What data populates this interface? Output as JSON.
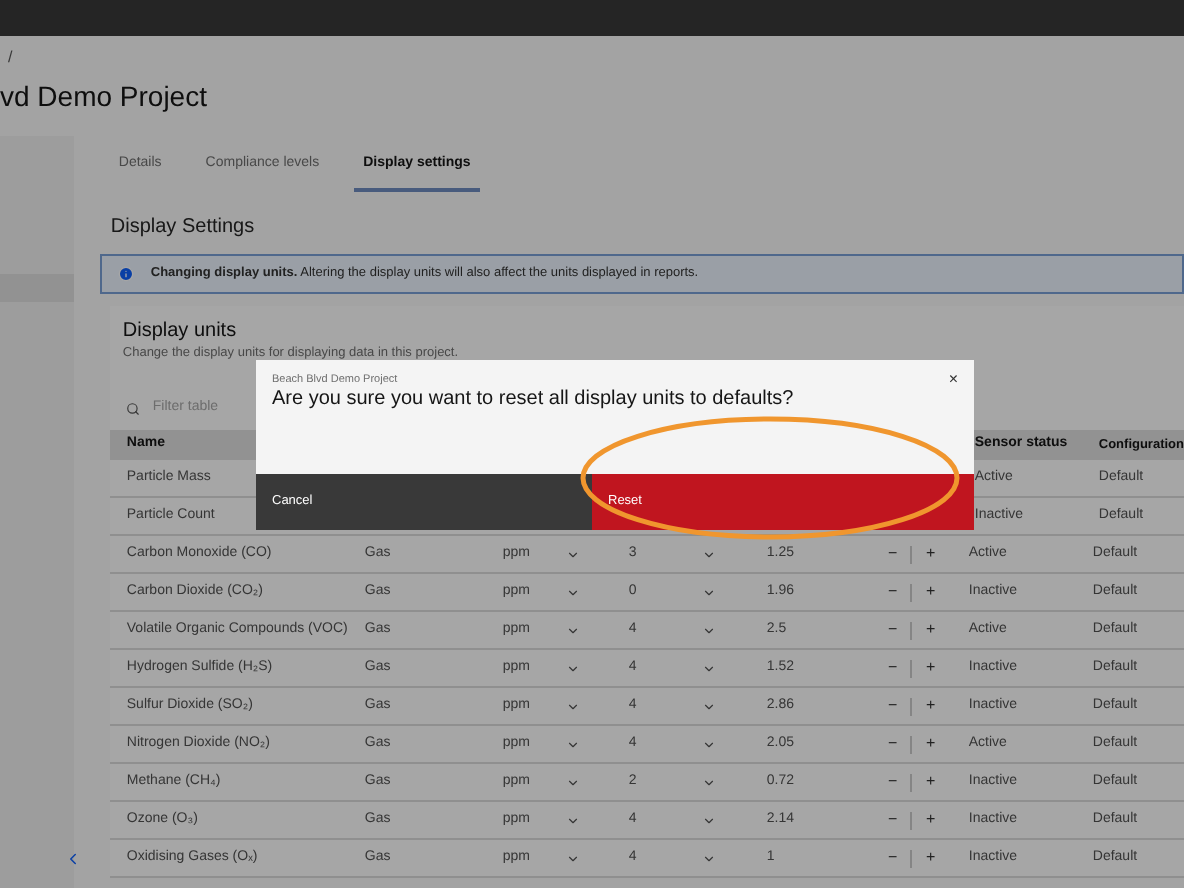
{
  "breadcrumb": "/",
  "project_title": "vd Demo Project",
  "tabs": [
    {
      "label": "Details",
      "selected": false
    },
    {
      "label": "Compliance levels",
      "selected": false
    },
    {
      "label": "Display settings",
      "selected": true
    }
  ],
  "section_title": "Display Settings",
  "notification": {
    "text": "**Changing display units.** Altering the display units will also affect the units displayed in reports."
  },
  "card": {
    "title": "Display units",
    "subtitle": "Change the display units for displaying data in this project."
  },
  "search": {
    "placeholder": "Filter table"
  },
  "table": {
    "columns": [
      "Name",
      "Sensor status",
      "Configuration"
    ],
    "rows": [
      {
        "name": "Particle Mass",
        "status": "Active",
        "config": "Default"
      },
      {
        "name": "Particle Count",
        "status": "Inactive",
        "config": "Default"
      },
      {
        "name": "Carbon Monoxide (CO)",
        "type": "Gas",
        "unit": "ppm",
        "decimals": "3",
        "value": "1.25",
        "minus": "−",
        "plus": "+",
        "status": "Active",
        "config": "Default"
      },
      {
        "name": "Carbon Dioxide (CO₂)",
        "type": "Gas",
        "unit": "ppm",
        "decimals": "0",
        "value": "1.96",
        "minus": "−",
        "plus": "+",
        "status": "Inactive",
        "config": "Default"
      },
      {
        "name": "Volatile Organic Compounds (VOC)",
        "type": "Gas",
        "unit": "ppm",
        "decimals": "4",
        "value": "2.5",
        "minus": "−",
        "plus": "+",
        "status": "Active",
        "config": "Default"
      },
      {
        "name": "Hydrogen Sulfide (H₂S)",
        "type": "Gas",
        "unit": "ppm",
        "decimals": "4",
        "value": "1.52",
        "minus": "−",
        "plus": "+",
        "status": "Inactive",
        "config": "Default"
      },
      {
        "name": "Sulfur Dioxide (SO₂)",
        "type": "Gas",
        "unit": "ppm",
        "decimals": "4",
        "value": "2.86",
        "minus": "−",
        "plus": "+",
        "status": "Inactive",
        "config": "Default"
      },
      {
        "name": "Nitrogen Dioxide (NO₂)",
        "type": "Gas",
        "unit": "ppm",
        "decimals": "4",
        "value": "2.05",
        "minus": "−",
        "plus": "+",
        "status": "Active",
        "config": "Default"
      },
      {
        "name": "Methane (CH₄)",
        "type": "Gas",
        "unit": "ppm",
        "decimals": "2",
        "value": "0.72",
        "minus": "−",
        "plus": "+",
        "status": "Inactive",
        "config": "Default"
      },
      {
        "name": "Ozone (O₃)",
        "type": "Gas",
        "unit": "ppm",
        "decimals": "4",
        "value": "2.14",
        "minus": "−",
        "plus": "+",
        "status": "Inactive",
        "config": "Default"
      },
      {
        "name": "Oxidising Gases (Oₓ)",
        "type": "Gas",
        "unit": "ppm",
        "decimals": "4",
        "value": "1",
        "minus": "−",
        "plus": "+",
        "status": "Inactive",
        "config": "Default"
      }
    ]
  },
  "modal": {
    "label": "Beach Blvd Demo Project",
    "heading": "Are you sure you want to reset all display units to defaults?",
    "close": "×",
    "buttons": [
      {
        "label": "Cancel",
        "kind": "secondary"
      },
      {
        "label": "Reset",
        "kind": "danger"
      }
    ]
  }
}
